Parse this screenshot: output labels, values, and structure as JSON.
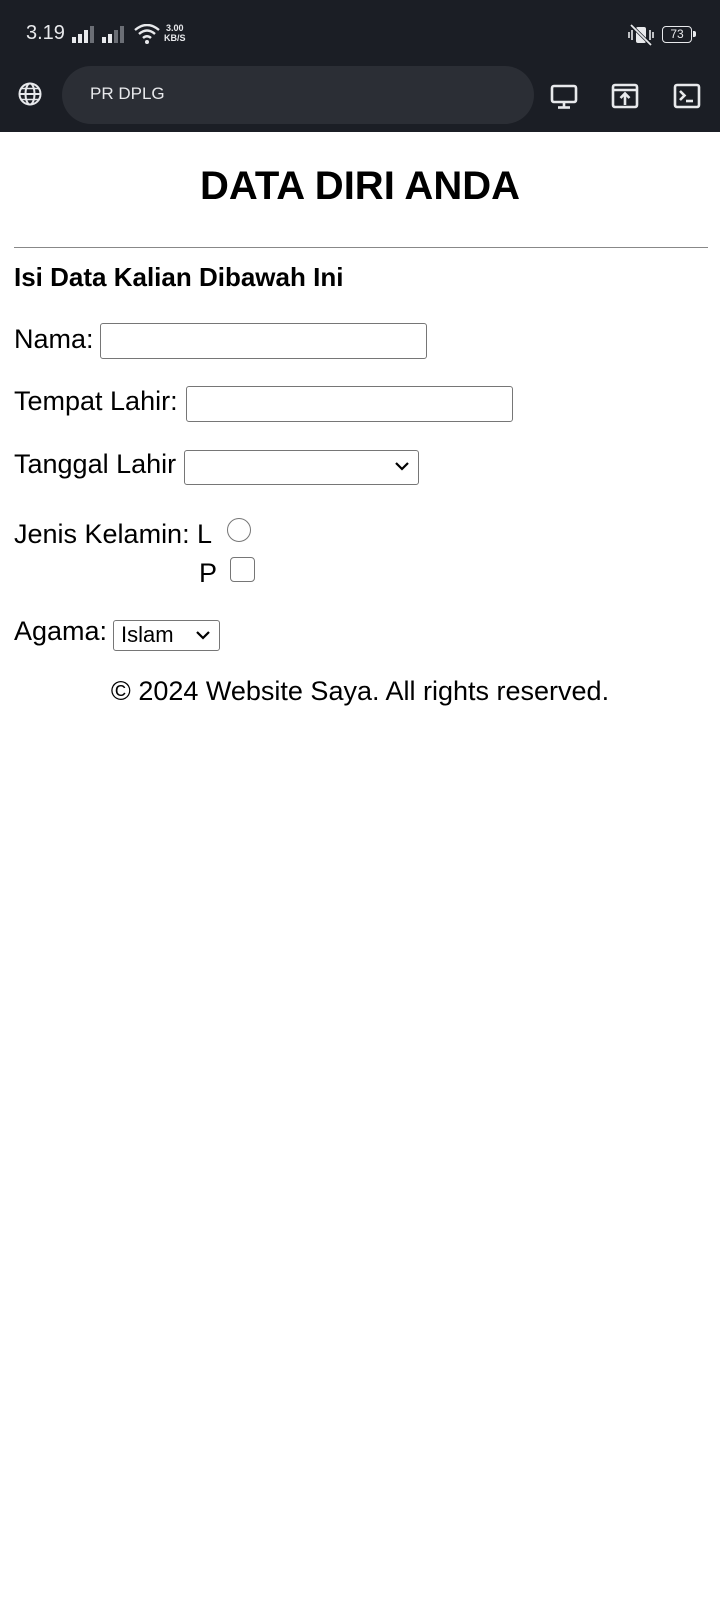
{
  "status_bar": {
    "time": "3.19",
    "net_speed_value": "3.00",
    "net_speed_unit": "KB/S",
    "battery": "73"
  },
  "browser": {
    "url_title": "PR DPLG"
  },
  "page": {
    "title": "DATA DIRI ANDA",
    "subtitle": "Isi Data Kalian Dibawah Ini",
    "form": {
      "nama_label": "Nama:",
      "nama_value": "",
      "tempat_lahir_label": "Tempat Lahir:",
      "tempat_lahir_value": "",
      "tanggal_lahir_label": "Tanggal Lahir",
      "tanggal_lahir_selected": "",
      "jenis_kelamin_label": "Jenis Kelamin:",
      "gender_l_label": "L",
      "gender_p_label": "P",
      "agama_label": "Agama:",
      "agama_selected": "Islam"
    },
    "footer": "© 2024 Website Saya. All rights reserved."
  }
}
